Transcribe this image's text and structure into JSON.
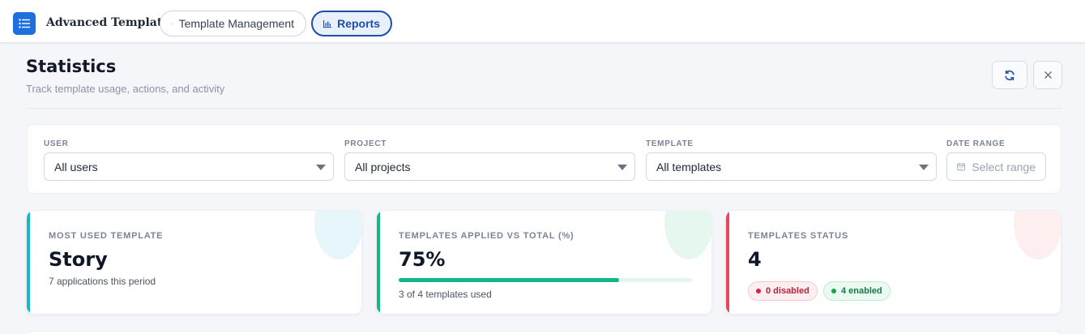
{
  "app": {
    "title": "Advanced Template"
  },
  "nav": {
    "template_management": "Template Management",
    "reports": "Reports"
  },
  "header": {
    "title": "Statistics",
    "subtitle": "Track template usage, actions, and activity",
    "refresh_icon": "refresh-icon",
    "close_icon": "close-icon"
  },
  "filters": {
    "user": {
      "label": "USER",
      "value": "All users"
    },
    "project": {
      "label": "PROJECT",
      "value": "All projects"
    },
    "template": {
      "label": "TEMPLATE",
      "value": "All templates"
    },
    "date_range": {
      "label": "DATE RANGE",
      "placeholder": "Select range",
      "icon": "calendar-icon"
    }
  },
  "cards": {
    "most_used": {
      "label": "MOST USED TEMPLATE",
      "value": "Story",
      "sub": "7 applications this period",
      "accent": "#15b8c7"
    },
    "applied": {
      "label": "TEMPLATES APPLIED VS TOTAL (%)",
      "value": "75%",
      "progress": 0.75,
      "sub": "3 of 4 templates used",
      "accent": "#12b886"
    },
    "status": {
      "label": "TEMPLATES STATUS",
      "value": "4",
      "disabled": "0 disabled",
      "enabled": "4 enabled",
      "accent": "#e8445c"
    }
  },
  "colors": {
    "brand": "#1d6fe0",
    "active_tab": "#1d4ea8"
  }
}
